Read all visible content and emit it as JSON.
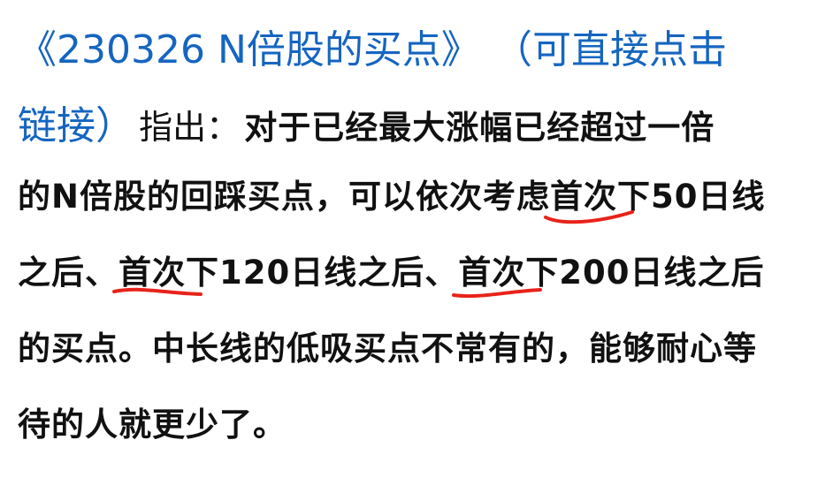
{
  "link": {
    "title": "《230326 N倍股的买点》",
    "note_part1": "（可直接点击",
    "note_part2": "链接）"
  },
  "lead": "指出：",
  "lines": {
    "l2_rest": "对于已经最大涨幅已经超过一倍",
    "l3_a": "的N倍股的回踩买点，可以依次考虑",
    "l3_hl": "首次下50日线",
    "l4_a": "之后、",
    "l4_hl1": "首次下120日线",
    "l4_b": "之后、",
    "l4_hl2": "首次下200日线之后",
    "l5": "的买点。中长线的低吸买点不常有的，能够耐心等",
    "l6": "待的人就更少了。"
  },
  "colors": {
    "link": "#1565c0",
    "underline": "#e8231a",
    "text": "#111111"
  }
}
